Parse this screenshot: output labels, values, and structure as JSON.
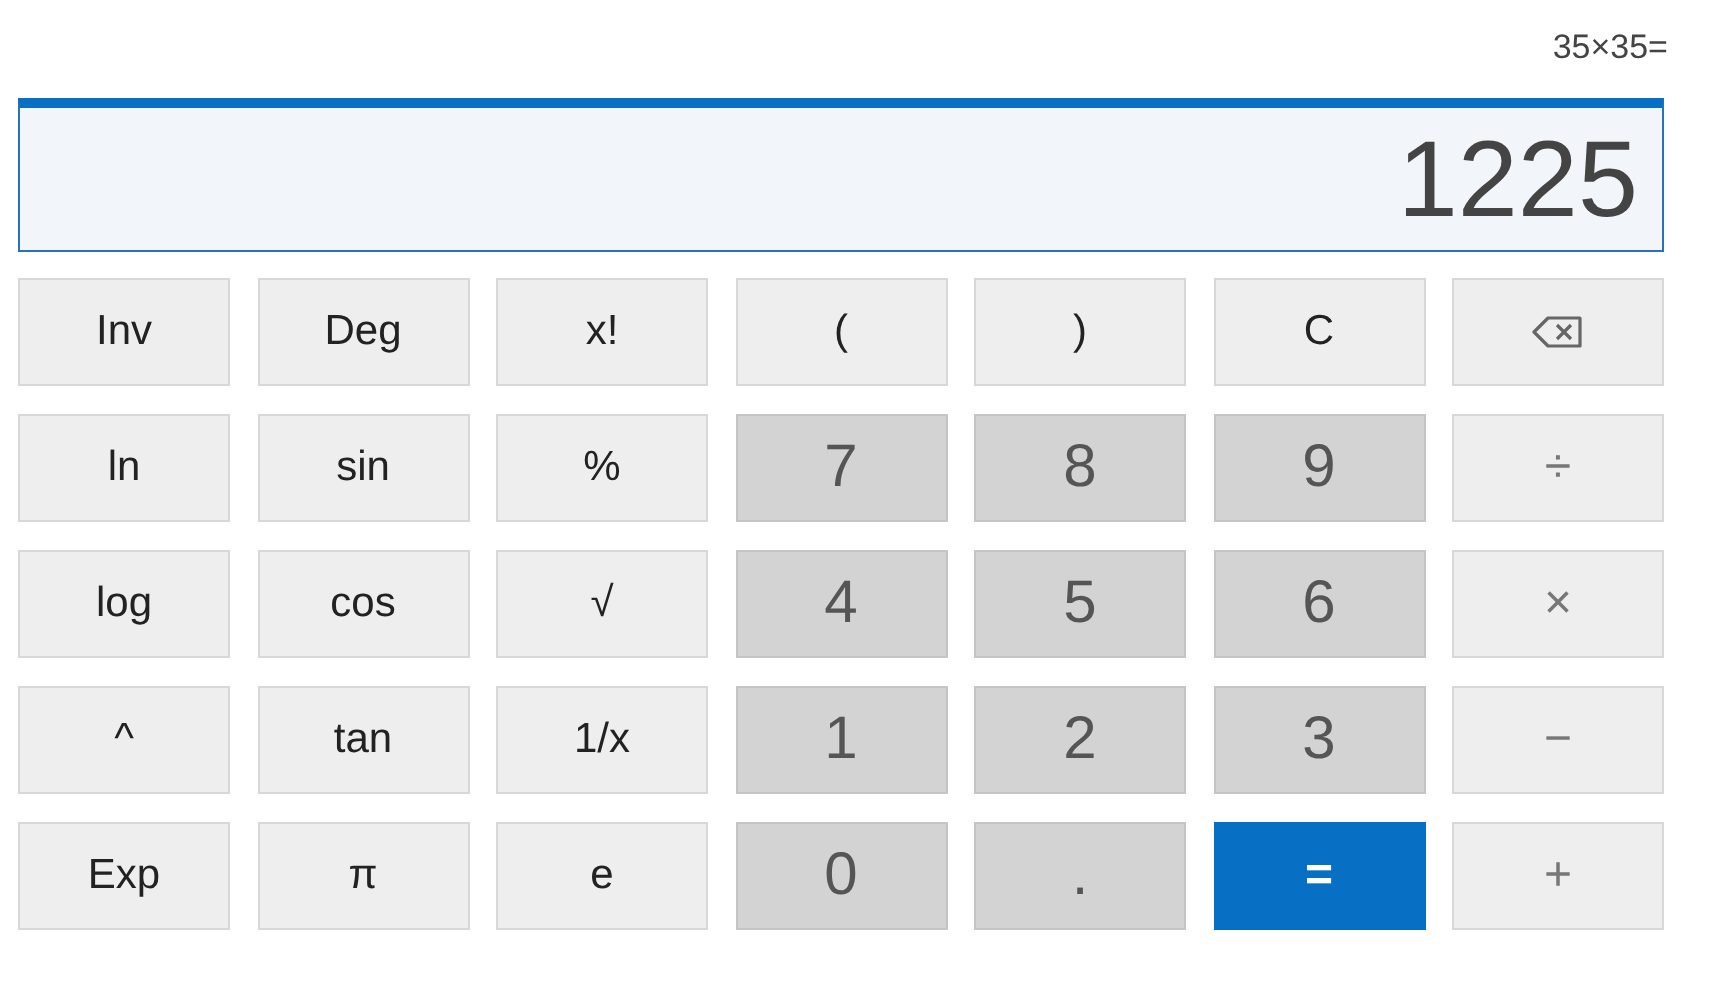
{
  "expression": "35×35=",
  "display": {
    "value": "1225"
  },
  "keys": [
    {
      "label": "Inv",
      "kind": "fn"
    },
    {
      "label": "Deg",
      "kind": "fn"
    },
    {
      "label": "x!",
      "kind": "fn"
    },
    {
      "label": "(",
      "kind": "fn"
    },
    {
      "label": ")",
      "kind": "fn"
    },
    {
      "label": "C",
      "kind": "fn"
    },
    {
      "kind": "backspace"
    },
    {
      "label": "ln",
      "kind": "fn"
    },
    {
      "label": "sin",
      "kind": "fn"
    },
    {
      "label": "%",
      "kind": "fn"
    },
    {
      "label": "7",
      "kind": "digit"
    },
    {
      "label": "8",
      "kind": "digit"
    },
    {
      "label": "9",
      "kind": "digit"
    },
    {
      "label": "÷",
      "kind": "op"
    },
    {
      "label": "log",
      "kind": "fn"
    },
    {
      "label": "cos",
      "kind": "fn"
    },
    {
      "label": "√",
      "kind": "fn"
    },
    {
      "label": "4",
      "kind": "digit"
    },
    {
      "label": "5",
      "kind": "digit"
    },
    {
      "label": "6",
      "kind": "digit"
    },
    {
      "label": "×",
      "kind": "op"
    },
    {
      "label": "^",
      "kind": "fn"
    },
    {
      "label": "tan",
      "kind": "fn"
    },
    {
      "label": "1/x",
      "kind": "fn"
    },
    {
      "label": "1",
      "kind": "digit"
    },
    {
      "label": "2",
      "kind": "digit"
    },
    {
      "label": "3",
      "kind": "digit"
    },
    {
      "label": "−",
      "kind": "op"
    },
    {
      "label": "Exp",
      "kind": "fn"
    },
    {
      "label": "π",
      "kind": "fn"
    },
    {
      "label": "e",
      "kind": "fn"
    },
    {
      "label": "0",
      "kind": "digit"
    },
    {
      "label": ".",
      "kind": "digit"
    },
    {
      "label": "=",
      "kind": "equals"
    },
    {
      "label": "+",
      "kind": "op"
    }
  ]
}
